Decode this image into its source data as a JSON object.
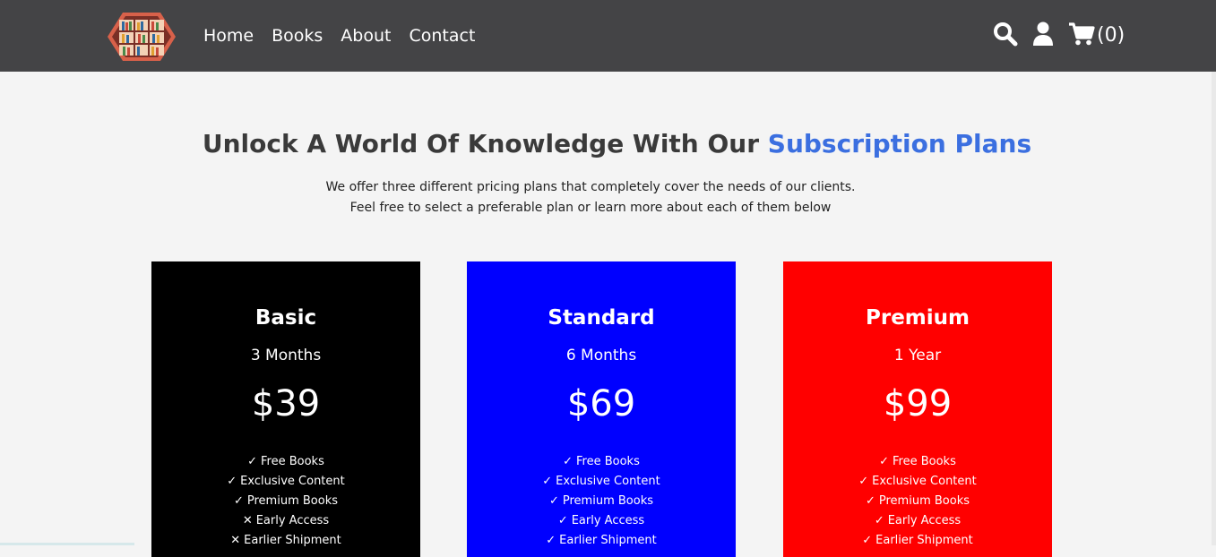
{
  "nav": {
    "links": [
      "Home",
      "Books",
      "About",
      "Contact"
    ],
    "cart_count": "(0)"
  },
  "hero": {
    "title_main": "Unlock A World Of Knowledge With Our ",
    "title_accent": "Subscription Plans",
    "subtitle_line1": "We offer three different pricing plans that completely cover the needs of our clients.",
    "subtitle_line2": "Feel free to select a preferable plan or learn more about each of them below",
    "accent_color": "#3b6fe0"
  },
  "plans": [
    {
      "name": "Basic",
      "duration": "3 Months",
      "price": "$39",
      "color": "#000000",
      "features": [
        {
          "mark": "✓",
          "label": "Free Books"
        },
        {
          "mark": "✓",
          "label": "Exclusive Content"
        },
        {
          "mark": "✓",
          "label": "Premium Books"
        },
        {
          "mark": "✕",
          "label": "Early Access"
        },
        {
          "mark": "✕",
          "label": "Earlier Shipment"
        }
      ]
    },
    {
      "name": "Standard",
      "duration": "6 Months",
      "price": "$69",
      "color": "#0000ff",
      "features": [
        {
          "mark": "✓",
          "label": "Free Books"
        },
        {
          "mark": "✓",
          "label": "Exclusive Content"
        },
        {
          "mark": "✓",
          "label": "Premium Books"
        },
        {
          "mark": "✓",
          "label": "Early Access"
        },
        {
          "mark": "✓",
          "label": "Earlier Shipment"
        }
      ]
    },
    {
      "name": "Premium",
      "duration": "1 Year",
      "price": "$99",
      "color": "#ff0000",
      "features": [
        {
          "mark": "✓",
          "label": "Free Books"
        },
        {
          "mark": "✓",
          "label": "Exclusive Content"
        },
        {
          "mark": "✓",
          "label": "Premium Books"
        },
        {
          "mark": "✓",
          "label": "Early Access"
        },
        {
          "mark": "✓",
          "label": "Earlier Shipment"
        }
      ]
    }
  ],
  "icons": {
    "logo": "bookshelf-logo-icon",
    "search": "search-icon",
    "user": "user-icon",
    "cart": "cart-icon"
  }
}
